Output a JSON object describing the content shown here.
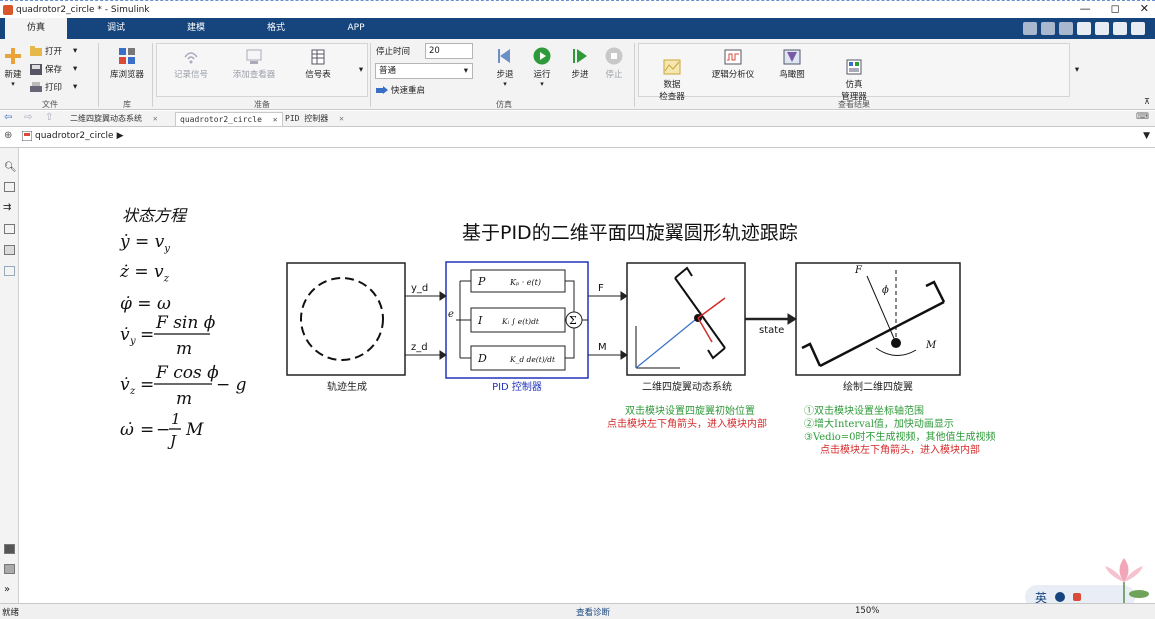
{
  "window": {
    "title": "quadrotor2_circle * - Simulink",
    "controls": [
      "—",
      "◻",
      "✕"
    ]
  },
  "tabs": [
    {
      "label": "仿真",
      "active": true
    },
    {
      "label": "调试",
      "active": false
    },
    {
      "label": "建模",
      "active": false
    },
    {
      "label": "格式",
      "active": false
    },
    {
      "label": "APP",
      "active": false
    }
  ],
  "ribbon": {
    "file": {
      "new_label": "新建",
      "open_label": "打开",
      "save_label": "保存",
      "print_label": "打印",
      "group_label": "文件"
    },
    "library": {
      "browser_label": "库浏览器",
      "group_label": "库"
    },
    "prepare": {
      "log_signals": "记录信号",
      "add_viewer": "添加查看器",
      "signal_table": "信号表",
      "group_label": "准备"
    },
    "simulate": {
      "stop_time_label": "停止时间",
      "stop_time_value": "20",
      "mode_value": "普通",
      "fast_restart_label": "快速重启",
      "step_back": "步退",
      "run": "运行",
      "step_forward": "步进",
      "stop": "停止",
      "group_label": "仿真"
    },
    "review": {
      "data_inspector": "数据\n检查器",
      "logic_analyzer": "逻辑分析仪",
      "birds_eye": "鸟瞰图",
      "sim_manager": "仿真\n管理器",
      "group_label": "查看结果"
    }
  },
  "doc_tabs": [
    {
      "label": "二维四旋翼动态系统",
      "active": false
    },
    {
      "label": "quadrotor2_circle",
      "active": true
    },
    {
      "label": "PID 控制器",
      "active": false
    }
  ],
  "address": {
    "model": "quadrotor2_circle"
  },
  "canvas": {
    "state_eq_title": "状态方程",
    "equations": [
      "ẏ = v_y",
      "ż = v_z",
      "φ̇ = ω"
    ],
    "diagram_title": "基于PID的二维平面四旋翼圆形轨迹跟踪",
    "blocks": {
      "trajectory": {
        "label": "轨迹生成",
        "out1": "y_d",
        "out2": "z_d"
      },
      "pid": {
        "label": "PID 控制器",
        "in": "e",
        "out1": "F",
        "out2": "M",
        "p": "P",
        "i": "I",
        "d": "D"
      },
      "dynamics": {
        "label": "二维四旋翼动态系统",
        "out": "state"
      },
      "draw": {
        "label": "绘制二维四旋翼",
        "F": "F",
        "phi": "ϕ",
        "M": "M"
      }
    },
    "notes_green_left": [
      "双击模块设置四旋翼初始位置"
    ],
    "notes_red_left": [
      "点击模块左下角箭头，进入模块内部"
    ],
    "notes_green_right": [
      "①双击模块设置坐标轴范围",
      "②增大Interval值，加快动画显示",
      "③Vedio=0时不生成视频，其他值生成视频"
    ],
    "notes_red_right": [
      "点击模块左下角箭头，进入模块内部"
    ],
    "ime_label": "英"
  },
  "status": {
    "left": "就绪",
    "center": "查看诊断",
    "zoom": "150%"
  },
  "colors": {
    "accent": "#16457e",
    "pid_blue": "#2233bb",
    "note_green": "#2e9a3a",
    "note_red": "#d62b2b"
  }
}
